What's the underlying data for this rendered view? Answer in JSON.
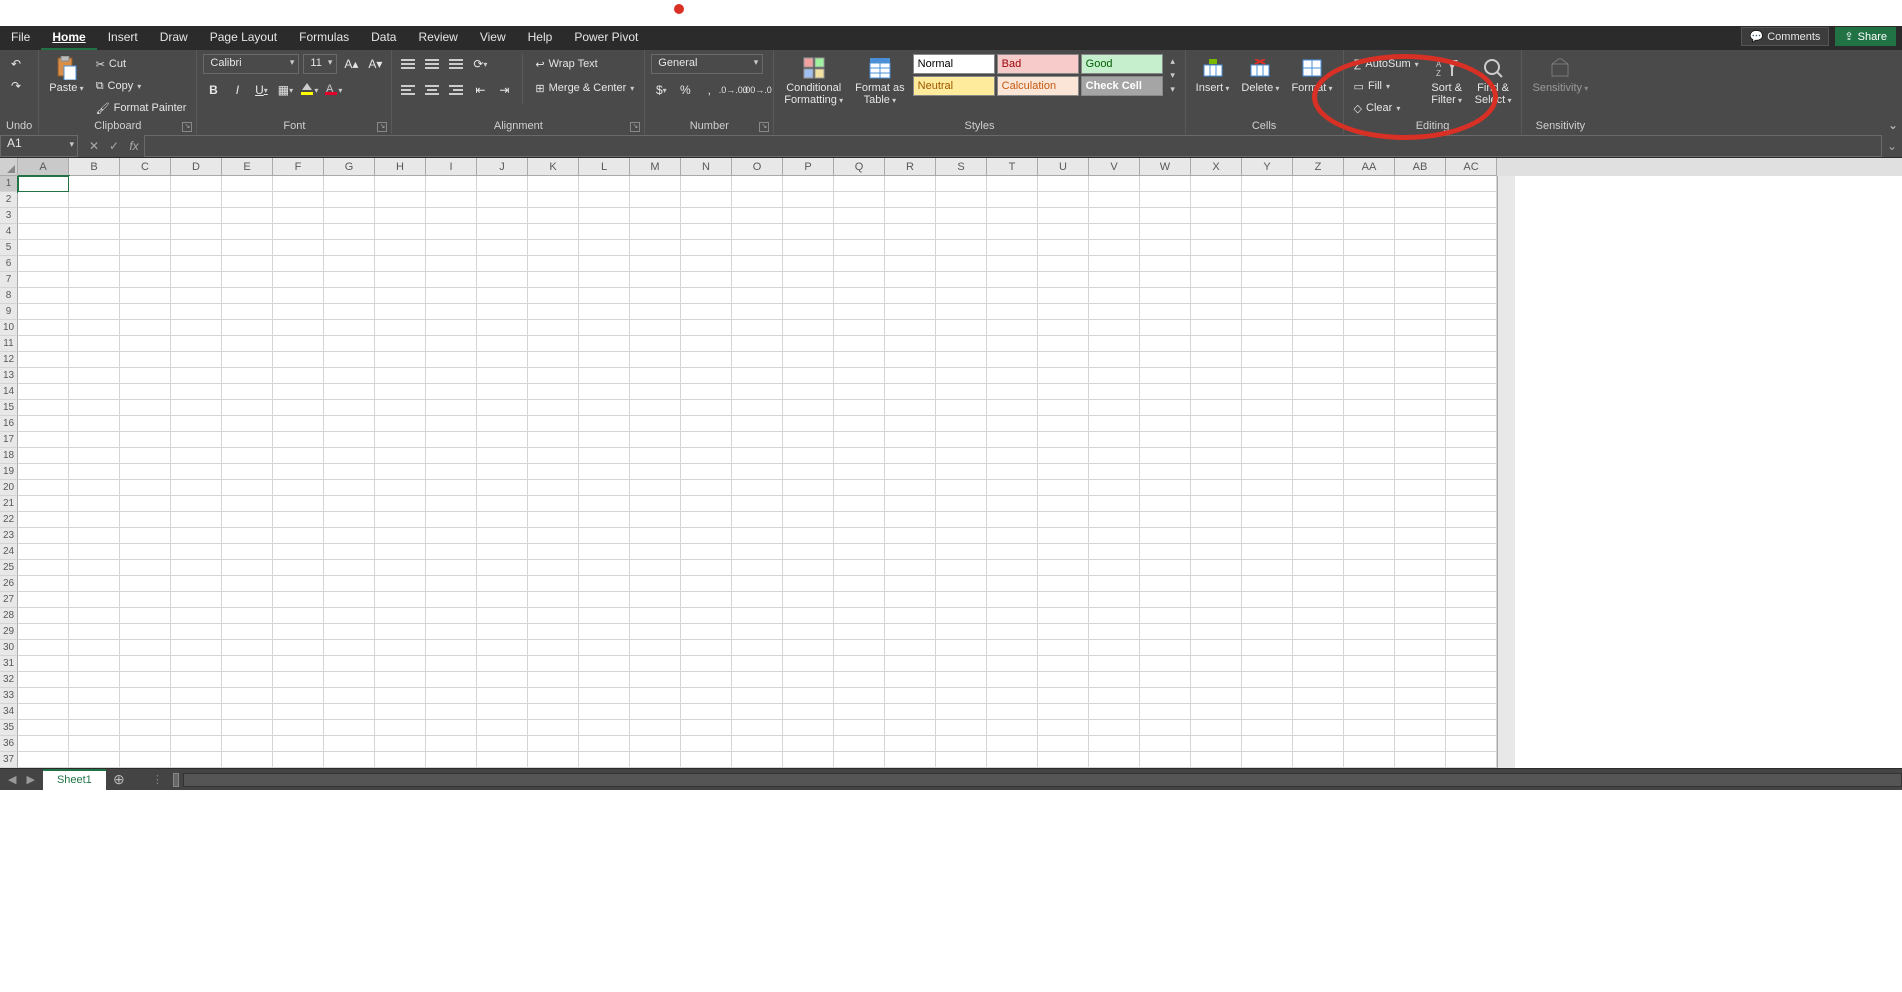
{
  "menubar": {
    "tabs": [
      "File",
      "Home",
      "Insert",
      "Draw",
      "Page Layout",
      "Formulas",
      "Data",
      "Review",
      "View",
      "Help",
      "Power Pivot"
    ],
    "active": "Home",
    "comments": "Comments",
    "share": "Share"
  },
  "ribbon": {
    "undo": {
      "label": "Undo"
    },
    "clipboard": {
      "label": "Clipboard",
      "paste": "Paste",
      "cut": "Cut",
      "copy": "Copy",
      "format_painter": "Format Painter"
    },
    "font": {
      "label": "Font",
      "name": "Calibri",
      "size": "11"
    },
    "alignment": {
      "label": "Alignment",
      "wrap": "Wrap Text",
      "merge": "Merge & Center"
    },
    "number": {
      "label": "Number",
      "format": "General"
    },
    "styles": {
      "label": "Styles",
      "cond_fmt1": "Conditional",
      "cond_fmt2": "Formatting",
      "fmt_table1": "Format as",
      "fmt_table2": "Table",
      "items": [
        {
          "name": "Normal",
          "bg": "#ffffff",
          "fg": "#000000"
        },
        {
          "name": "Bad",
          "bg": "#f8cbcb",
          "fg": "#9c0006"
        },
        {
          "name": "Good",
          "bg": "#c6efce",
          "fg": "#006100"
        },
        {
          "name": "Neutral",
          "bg": "#ffeb9c",
          "fg": "#9c5700"
        },
        {
          "name": "Calculation",
          "bg": "#fbe5d6",
          "fg": "#c65911"
        },
        {
          "name": "Check Cell",
          "bg": "#a5a5a5",
          "fg": "#ffffff"
        }
      ]
    },
    "cells": {
      "label": "Cells",
      "insert": "Insert",
      "delete": "Delete",
      "format": "Format"
    },
    "editing": {
      "label": "Editing",
      "autosum": "AutoSum",
      "fill": "Fill",
      "clear": "Clear",
      "sort1": "Sort &",
      "sort2": "Filter",
      "find1": "Find &",
      "find2": "Select"
    },
    "sensitivity": {
      "label": "Sensitivity",
      "btn": "Sensitivity"
    }
  },
  "formula_bar": {
    "namebox": "A1",
    "formula": ""
  },
  "sheet": {
    "columns": [
      "A",
      "B",
      "C",
      "D",
      "E",
      "F",
      "G",
      "H",
      "I",
      "J",
      "K",
      "L",
      "M",
      "N",
      "O",
      "P",
      "Q",
      "R",
      "S",
      "T",
      "U",
      "V",
      "W",
      "X",
      "Y",
      "Z",
      "AA",
      "AB",
      "AC"
    ],
    "rows_visible": 37,
    "selected_cell": "A1",
    "tab_name": "Sheet1"
  }
}
